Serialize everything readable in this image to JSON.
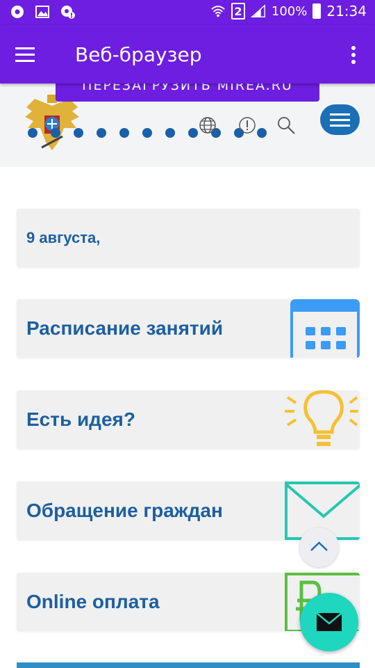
{
  "status_bar": {
    "sim_number": "2",
    "battery": "100%",
    "time": "21:34"
  },
  "app_bar": {
    "title": "Веб-браузер"
  },
  "banner": {
    "label": "ПЕРЕЗАГРУЗИТЬ MIREA.RU"
  },
  "cards": {
    "date": "9 августа,",
    "schedule": "Расписание занятий",
    "idea": "Есть идея?",
    "appeal": "Обращение граждан",
    "payment": "Online оплата"
  },
  "colors": {
    "app_bar": "#6d1ee0",
    "link_text": "#1d5fa0",
    "calendar_icon": "#3b9bf5",
    "idea_icon": "#f5c033",
    "mail_icon": "#25c7b0",
    "payment_icon": "#5bbf42",
    "fab": "#1fd6be"
  },
  "icons": {
    "header": [
      "globe-icon",
      "alert-icon",
      "search-icon"
    ],
    "cards": [
      "calendar-icon",
      "lightbulb-icon",
      "envelope-icon",
      "ruble-icon"
    ],
    "fab": [
      "chevron-up-icon",
      "mail-icon"
    ]
  }
}
